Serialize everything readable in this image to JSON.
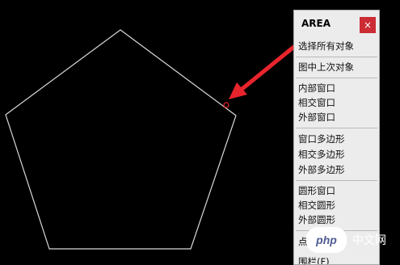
{
  "panel": {
    "title": "AREA",
    "close_label": "×",
    "items": [
      "选择所有对象",
      "图中上次对象",
      "内部窗口",
      "相交窗口",
      "外部窗口",
      "窗口多边形",
      "相交多边形",
      "外部多边形",
      "圆形窗口",
      "相交圆形",
      "外部圆形",
      "点",
      "围栏(F)"
    ]
  },
  "watermark": {
    "logo": "php",
    "text": "中文网"
  },
  "colors": {
    "background": "#000000",
    "pentagon_stroke": "#d9d9d9",
    "arrow": "#e8242c",
    "close_button": "#cc2c34"
  }
}
